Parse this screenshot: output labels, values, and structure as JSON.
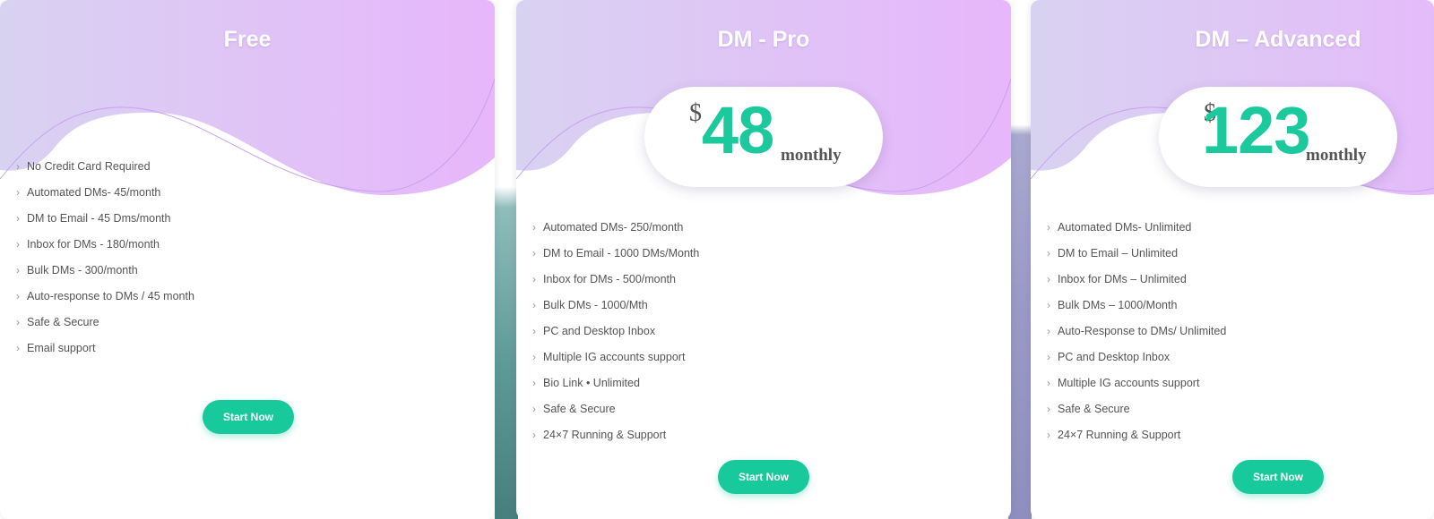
{
  "plans": [
    {
      "title": "Free",
      "features": [
        "No Credit Card Required",
        "Automated DMs- 45/month",
        "DM to Email - 45 Dms/month",
        "Inbox for DMs - 180/month",
        "Bulk DMs - 300/month",
        "Auto-response to DMs / 45 month",
        "Safe & Secure",
        "Email support"
      ],
      "button": "Start Now"
    },
    {
      "title": "DM - Pro",
      "price": {
        "currency": "$",
        "amount": "48",
        "period": "monthly"
      },
      "features": [
        "Automated DMs- 250/month",
        "DM to Email - 1000 DMs/Month",
        "Inbox for DMs - 500/month",
        "Bulk DMs - 1000/Mth",
        "PC and Desktop Inbox",
        "Multiple IG accounts support",
        "Bio Link • Unlimited",
        "Safe & Secure",
        "24×7 Running & Support"
      ],
      "button": "Start Now"
    },
    {
      "title": "DM – Advanced",
      "price": {
        "currency": "$",
        "amount": "123",
        "period": "monthly"
      },
      "features": [
        "Automated DMs- Unlimited",
        "DM to Email – Unlimited",
        "Inbox for DMs – Unlimited",
        "Bulk DMs – 1000/Month",
        "Auto-Response to DMs/ Unlimited",
        "PC and Desktop Inbox",
        "Multiple IG accounts support",
        "Safe & Secure",
        "24×7 Running & Support"
      ],
      "button": "Start Now"
    }
  ],
  "colors": {
    "accent": "#18c99b",
    "header_gradient_start": "#d8d2f1",
    "header_gradient_end": "#e7b6fb",
    "text": "#555555"
  },
  "icons": {
    "feature_bullet": "chevron-right-icon"
  }
}
